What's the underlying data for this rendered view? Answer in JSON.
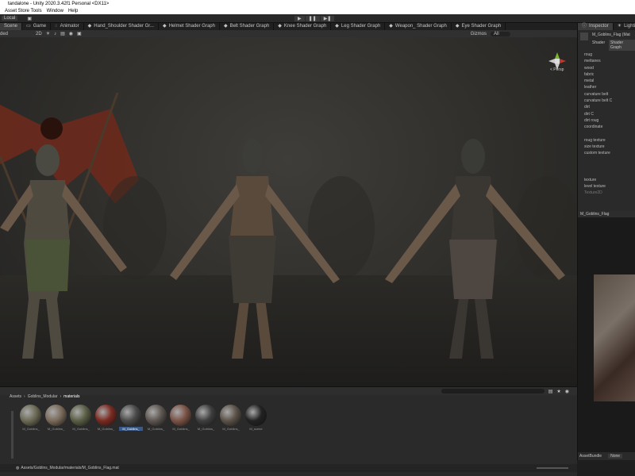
{
  "app": {
    "title": "tandalone - Unity 2020.3.42f1 Personal <DX11>"
  },
  "menu": [
    "Asset Store Tools",
    "Window",
    "Help"
  ],
  "toolbar": {
    "local": "Local"
  },
  "tabs": [
    {
      "label": "Scene",
      "active": true
    },
    {
      "label": "Game"
    },
    {
      "label": "Animator"
    },
    {
      "label": "Hand_Shoulder Shader Gr..."
    },
    {
      "label": "Helmet Shader Graph"
    },
    {
      "label": "Belt Shader Graph"
    },
    {
      "label": "Knee Shader Graph"
    },
    {
      "label": "Leg Shader Graph"
    },
    {
      "label": "Weapon_ Shader Graph"
    },
    {
      "label": "Eye Shader Graph"
    }
  ],
  "scenebar": {
    "shading": "ded",
    "mode2d": "2D",
    "gizmos": "Gizmos",
    "search": "All"
  },
  "viewport": {
    "persp": "< Persp"
  },
  "inspector": {
    "tab_inspector": "Inspector",
    "tab_lighting": "Lighting",
    "material": "M_Goblins_Flag (Mat",
    "shader_label": "Shader",
    "shader_value": "Shader Graph",
    "props": [
      "roug",
      "mettanes",
      "wood",
      "fabric",
      "metal",
      "leather",
      "curvature belt",
      "curvature belt C",
      "dirt",
      "dirt C",
      "dirt roug",
      "coordinate",
      "",
      "roug texture",
      "size texture",
      "custom texture",
      "",
      "",
      "",
      "texture",
      "level texture",
      "Texture2D"
    ]
  },
  "preview": {
    "title": "M_Goblins_Flag",
    "assetbundle_label": "AssetBundle",
    "assetbundle_value": "None"
  },
  "project": {
    "breadcrumb": [
      "Assets",
      "Goblins_Modular",
      "materials"
    ],
    "slider_count": "14",
    "assets": [
      {
        "label": "M_Goblins_",
        "color": "#6b6a55"
      },
      {
        "label": "M_Goblins_",
        "color": "#7a6a5a"
      },
      {
        "label": "M_Goblins_",
        "color": "#5a5e45"
      },
      {
        "label": "M_Goblins_",
        "color": "#7a2a20"
      },
      {
        "label": "M_Goblins_",
        "color": "#4a4a4a",
        "selected": true
      },
      {
        "label": "M_Goblins_",
        "color": "#5d5550"
      },
      {
        "label": "M_Goblins_",
        "color": "#7a5245"
      },
      {
        "label": "M_Goblins_",
        "color": "#3e3e3e"
      },
      {
        "label": "M_Goblins_",
        "color": "#5b5248"
      },
      {
        "label": "M_scene",
        "color": "#222"
      }
    ],
    "status_path": "Assets/Goblins_Modular/materials/M_Goblins_Flag.mat"
  }
}
